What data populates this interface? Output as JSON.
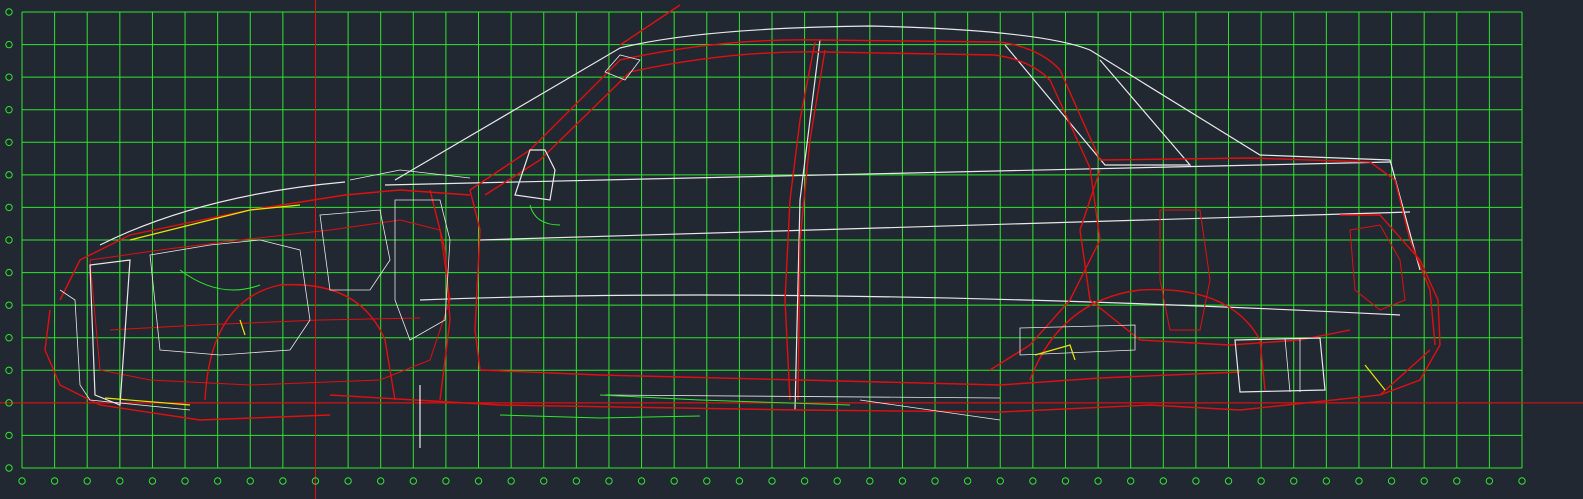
{
  "viewport": {
    "background": "#222831",
    "grid_color": "#2ee62e",
    "axis_color": "#e01010",
    "outline_primary_color": "#e01010",
    "outline_secondary_color": "#e8e8e8",
    "accent_color": "#e6e600"
  },
  "drawing": {
    "subject": "car-body-side-view",
    "grid_columns": 47,
    "grid_rows": 14,
    "vertical_axis_column": 9,
    "horizontal_axis_row": 12
  }
}
